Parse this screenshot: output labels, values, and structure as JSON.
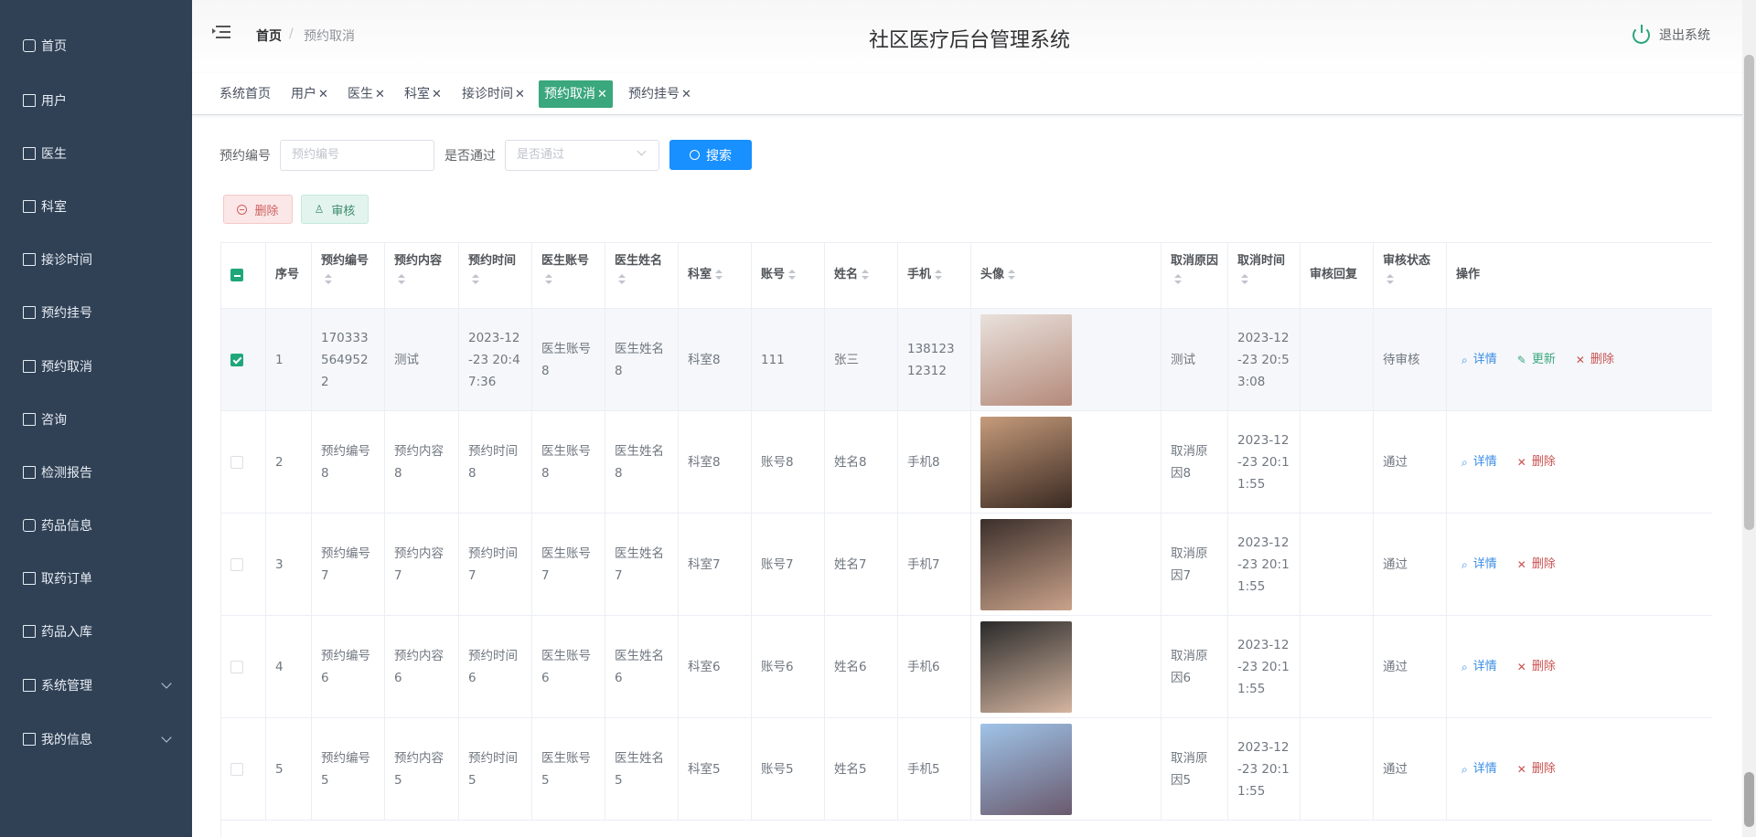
{
  "sidebar": {
    "items": [
      {
        "label": "首页",
        "icon": "home-icon"
      },
      {
        "label": "用户",
        "icon": "clipboard-icon"
      },
      {
        "label": "医生",
        "icon": "list-icon"
      },
      {
        "label": "科室",
        "icon": "building-icon"
      },
      {
        "label": "接诊时间",
        "icon": "chart-icon"
      },
      {
        "label": "预约挂号",
        "icon": "grid-icon"
      },
      {
        "label": "预约取消",
        "icon": "ticket-icon"
      },
      {
        "label": "咨询",
        "icon": "monitor-icon"
      },
      {
        "label": "检测报告",
        "icon": "report-icon"
      },
      {
        "label": "药品信息",
        "icon": "user-icon"
      },
      {
        "label": "取药订单",
        "icon": "grid-icon"
      },
      {
        "label": "药品入库",
        "icon": "grid-icon"
      },
      {
        "label": "系统管理",
        "icon": "bar-chart-icon"
      },
      {
        "label": "我的信息",
        "icon": "card-icon"
      }
    ]
  },
  "header": {
    "breadcrumb_home": "首页",
    "breadcrumb_sep": "/",
    "breadcrumb_current": "预约取消",
    "title": "社区医疗后台管理系统",
    "logout": "退出系统"
  },
  "tags": [
    {
      "label": "系统首页",
      "closable": false
    },
    {
      "label": "用户",
      "closable": true
    },
    {
      "label": "医生",
      "closable": true
    },
    {
      "label": "科室",
      "closable": true
    },
    {
      "label": "接诊时间",
      "closable": true
    },
    {
      "label": "预约取消",
      "closable": true,
      "active": true
    },
    {
      "label": "预约挂号",
      "closable": true
    }
  ],
  "search": {
    "order_no_label": "预约编号",
    "order_no_placeholder": "预约编号",
    "pass_label": "是否通过",
    "pass_placeholder": "是否通过",
    "button": "搜索"
  },
  "actions": {
    "delete": "删除",
    "audit": "审核"
  },
  "table": {
    "columns": [
      "序号",
      "预约编号",
      "预约内容",
      "预约时间",
      "医生账号",
      "医生姓名",
      "科室",
      "账号",
      "姓名",
      "手机",
      "头像",
      "取消原因",
      "取消时间",
      "审核回复",
      "审核状态",
      "操作"
    ],
    "op_labels": {
      "detail": "详情",
      "update": "更新",
      "delete": "删除"
    },
    "rows": [
      {
        "idx": "1",
        "order_no": "1703335649522",
        "content": "测试",
        "time": "2023-12-23 20:47:36",
        "doc_acc": "医生账号8",
        "doc_name": "医生姓名8",
        "dept": "科室8",
        "acc": "111",
        "name": "张三",
        "phone": "13812312312",
        "reason": "测试",
        "cancel_time": "2023-12-23 20:53:08",
        "reply": "",
        "status": "待审核",
        "checked": true,
        "has_update": true,
        "avatar_colors": [
          "#e9e1dc",
          "#b48a7a"
        ]
      },
      {
        "idx": "2",
        "order_no": "预约编号8",
        "content": "预约内容8",
        "time": "预约时间8",
        "doc_acc": "医生账号8",
        "doc_name": "医生姓名8",
        "dept": "科室8",
        "acc": "账号8",
        "name": "姓名8",
        "phone": "手机8",
        "reason": "取消原因8",
        "cancel_time": "2023-12-23 20:11:55",
        "reply": "",
        "status": "通过",
        "checked": false,
        "has_update": false,
        "avatar_colors": [
          "#c69b7b",
          "#3a2a22"
        ]
      },
      {
        "idx": "3",
        "order_no": "预约编号7",
        "content": "预约内容7",
        "time": "预约时间7",
        "doc_acc": "医生账号7",
        "doc_name": "医生姓名7",
        "dept": "科室7",
        "acc": "账号7",
        "name": "姓名7",
        "phone": "手机7",
        "reason": "取消原因7",
        "cancel_time": "2023-12-23 20:11:55",
        "reply": "",
        "status": "通过",
        "checked": false,
        "has_update": false,
        "avatar_colors": [
          "#3b2f2b",
          "#c9a28a"
        ]
      },
      {
        "idx": "4",
        "order_no": "预约编号6",
        "content": "预约内容6",
        "time": "预约时间6",
        "doc_acc": "医生账号6",
        "doc_name": "医生姓名6",
        "dept": "科室6",
        "acc": "账号6",
        "name": "姓名6",
        "phone": "手机6",
        "reason": "取消原因6",
        "cancel_time": "2023-12-23 20:11:55",
        "reply": "",
        "status": "通过",
        "checked": false,
        "has_update": false,
        "avatar_colors": [
          "#2a2a2a",
          "#d4b5a0"
        ]
      },
      {
        "idx": "5",
        "order_no": "预约编号5",
        "content": "预约内容5",
        "time": "预约时间5",
        "doc_acc": "医生账号5",
        "doc_name": "医生姓名5",
        "dept": "科室5",
        "acc": "账号5",
        "name": "姓名5",
        "phone": "手机5",
        "reason": "取消原因5",
        "cancel_time": "2023-12-23 20:11:55",
        "reply": "",
        "status": "通过",
        "checked": false,
        "has_update": false,
        "avatar_colors": [
          "#9fc3e8",
          "#6a5a6e"
        ]
      }
    ]
  }
}
